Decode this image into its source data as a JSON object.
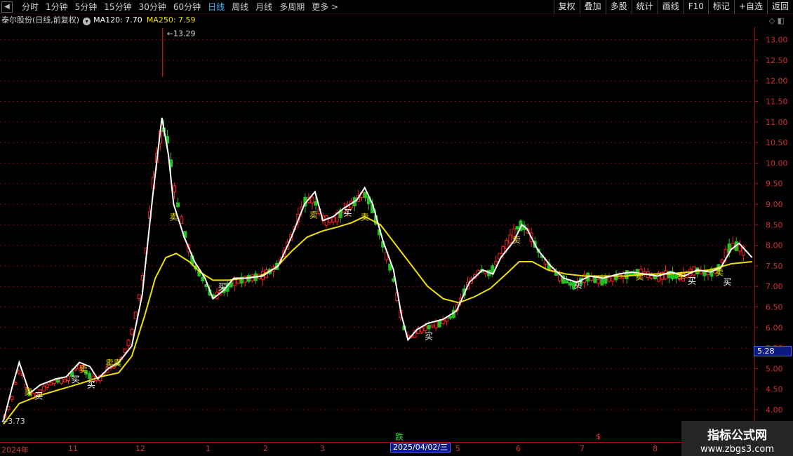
{
  "toolbar": {
    "nav_glyph": "◀",
    "periods": [
      {
        "label": "分时",
        "active": false
      },
      {
        "label": "1分钟",
        "active": false
      },
      {
        "label": "5分钟",
        "active": false
      },
      {
        "label": "15分钟",
        "active": false
      },
      {
        "label": "30分钟",
        "active": false
      },
      {
        "label": "60分钟",
        "active": false
      },
      {
        "label": "日线",
        "active": true
      },
      {
        "label": "周线",
        "active": false
      },
      {
        "label": "月线",
        "active": false
      },
      {
        "label": "多周期",
        "active": false
      },
      {
        "label": "更多 >",
        "active": false
      }
    ],
    "tools": [
      "复权",
      "叠加",
      "多股",
      "统计",
      "画线",
      "F10",
      "标记",
      "+自选",
      "返回"
    ]
  },
  "info": {
    "stock": "泰尔股份(日线,前复权)",
    "circle_glyph": "▾",
    "ma120_label": "MA120: 7.70",
    "ma250_label": "MA250: 7.59",
    "window_controls": "◇ ◧"
  },
  "colors": {
    "up": "#ff2020",
    "down": "#22c422",
    "ma120": "#ffffff",
    "ma250": "#f0e000",
    "grid": "#7a0a0a",
    "axis_text": "#d03030",
    "signal_sell": "#f0e000",
    "signal_buy": "#ffffff"
  },
  "chart_data": {
    "type": "candlestick",
    "y_ticks": [
      "4.00",
      "4.50",
      "5.00",
      "5.50",
      "6.00",
      "6.50",
      "7.00",
      "7.50",
      "8.00",
      "8.50",
      "9.00",
      "9.50",
      "10.00",
      "10.50",
      "11.00",
      "11.50",
      "12.00",
      "12.50",
      "13.00"
    ],
    "ylim": [
      3.6,
      13.3
    ],
    "high_marker": "13.29",
    "low_marker": "3.73",
    "current_price": "5.28",
    "price_trend": [
      [
        0,
        3.75
      ],
      [
        0.35,
        4.3
      ],
      [
        0.6,
        5.1
      ],
      [
        1,
        4.3
      ],
      [
        1.2,
        4.35
      ],
      [
        1.6,
        4.55
      ],
      [
        2.0,
        4.7
      ],
      [
        2.4,
        4.7
      ],
      [
        2.9,
        5.1
      ],
      [
        3.1,
        4.95
      ],
      [
        3.3,
        4.8
      ],
      [
        3.6,
        4.7
      ],
      [
        4.0,
        5.0
      ],
      [
        4.4,
        5.1
      ],
      [
        4.9,
        5.8
      ],
      [
        5.4,
        7.5
      ],
      [
        5.7,
        9.5
      ],
      [
        6.05,
        10.9
      ],
      [
        6.3,
        10.6
      ],
      [
        6.45,
        9.6
      ],
      [
        6.8,
        8.6
      ],
      [
        7.2,
        7.6
      ],
      [
        7.6,
        7.2
      ],
      [
        8.0,
        6.7
      ],
      [
        8.4,
        6.9
      ],
      [
        8.8,
        7.1
      ],
      [
        9.4,
        7.2
      ],
      [
        9.9,
        7.25
      ],
      [
        10.5,
        7.5
      ],
      [
        11.0,
        8.2
      ],
      [
        11.5,
        9.1
      ],
      [
        11.9,
        9.1
      ],
      [
        12.2,
        8.6
      ],
      [
        12.6,
        8.6
      ],
      [
        13.1,
        8.9
      ],
      [
        13.5,
        9.1
      ],
      [
        13.8,
        9.3
      ],
      [
        14.1,
        8.9
      ],
      [
        14.5,
        8.0
      ],
      [
        14.9,
        7.2
      ],
      [
        15.2,
        6.2
      ],
      [
        15.45,
        5.7
      ],
      [
        15.8,
        5.9
      ],
      [
        16.2,
        6.0
      ],
      [
        16.7,
        6.1
      ],
      [
        17.2,
        6.3
      ],
      [
        17.7,
        7.0
      ],
      [
        18.2,
        7.4
      ],
      [
        18.6,
        7.3
      ],
      [
        19.0,
        7.8
      ],
      [
        19.4,
        8.2
      ],
      [
        19.7,
        8.5
      ],
      [
        20.0,
        8.4
      ],
      [
        20.4,
        7.9
      ],
      [
        20.8,
        7.5
      ],
      [
        21.3,
        7.2
      ],
      [
        21.8,
        7.0
      ],
      [
        22.3,
        7.25
      ],
      [
        22.8,
        7.1
      ],
      [
        23.3,
        7.2
      ],
      [
        23.9,
        7.3
      ],
      [
        24.4,
        7.35
      ],
      [
        24.9,
        7.2
      ],
      [
        25.4,
        7.3
      ],
      [
        25.9,
        7.2
      ],
      [
        26.4,
        7.4
      ],
      [
        26.9,
        7.3
      ],
      [
        27.3,
        7.4
      ],
      [
        27.7,
        7.95
      ],
      [
        28.0,
        8.0
      ],
      [
        28.4,
        7.8
      ]
    ],
    "ma120": [
      [
        0,
        3.73
      ],
      [
        0.35,
        4.6
      ],
      [
        0.6,
        5.15
      ],
      [
        1,
        4.4
      ],
      [
        1.4,
        4.6
      ],
      [
        2.0,
        4.75
      ],
      [
        2.4,
        4.8
      ],
      [
        2.9,
        5.15
      ],
      [
        3.3,
        5.05
      ],
      [
        3.6,
        4.75
      ],
      [
        4.0,
        5.0
      ],
      [
        4.4,
        5.15
      ],
      [
        4.9,
        5.55
      ],
      [
        5.3,
        6.8
      ],
      [
        5.7,
        9.2
      ],
      [
        6.05,
        11.1
      ],
      [
        6.3,
        10.2
      ],
      [
        6.5,
        9.0
      ],
      [
        6.9,
        8.2
      ],
      [
        7.3,
        7.6
      ],
      [
        7.7,
        7.2
      ],
      [
        8.0,
        6.7
      ],
      [
        8.4,
        6.9
      ],
      [
        8.8,
        7.2
      ],
      [
        9.3,
        7.2
      ],
      [
        9.9,
        7.25
      ],
      [
        10.5,
        7.5
      ],
      [
        11.0,
        8.2
      ],
      [
        11.5,
        9.0
      ],
      [
        11.9,
        9.3
      ],
      [
        12.2,
        8.6
      ],
      [
        12.6,
        8.7
      ],
      [
        13.0,
        8.9
      ],
      [
        13.5,
        9.1
      ],
      [
        13.8,
        9.4
      ],
      [
        14.1,
        9.0
      ],
      [
        14.5,
        8.1
      ],
      [
        14.9,
        7.4
      ],
      [
        15.2,
        6.3
      ],
      [
        15.45,
        5.7
      ],
      [
        15.8,
        5.95
      ],
      [
        16.2,
        6.1
      ],
      [
        16.8,
        6.2
      ],
      [
        17.3,
        6.4
      ],
      [
        17.8,
        7.1
      ],
      [
        18.3,
        7.4
      ],
      [
        18.7,
        7.3
      ],
      [
        19.0,
        7.7
      ],
      [
        19.5,
        8.1
      ],
      [
        19.8,
        8.5
      ],
      [
        20.0,
        8.4
      ],
      [
        20.4,
        7.9
      ],
      [
        20.9,
        7.5
      ],
      [
        21.4,
        7.2
      ],
      [
        21.9,
        7.1
      ],
      [
        22.4,
        7.25
      ],
      [
        22.9,
        7.2
      ],
      [
        23.5,
        7.3
      ],
      [
        24.0,
        7.35
      ],
      [
        24.5,
        7.3
      ],
      [
        25.0,
        7.25
      ],
      [
        25.5,
        7.35
      ],
      [
        26.0,
        7.25
      ],
      [
        26.5,
        7.4
      ],
      [
        27.0,
        7.35
      ],
      [
        27.4,
        7.45
      ],
      [
        27.8,
        7.9
      ],
      [
        28.1,
        8.05
      ],
      [
        28.6,
        7.7
      ]
    ],
    "ma250": [
      [
        0,
        3.65
      ],
      [
        0.6,
        4.15
      ],
      [
        1.4,
        4.35
      ],
      [
        2.2,
        4.5
      ],
      [
        3.0,
        4.65
      ],
      [
        3.7,
        4.8
      ],
      [
        4.4,
        4.9
      ],
      [
        4.9,
        5.3
      ],
      [
        5.4,
        6.3
      ],
      [
        5.8,
        7.2
      ],
      [
        6.2,
        7.7
      ],
      [
        6.6,
        7.8
      ],
      [
        7.1,
        7.6
      ],
      [
        7.5,
        7.35
      ],
      [
        8.0,
        7.15
      ],
      [
        8.6,
        7.15
      ],
      [
        9.2,
        7.2
      ],
      [
        9.8,
        7.25
      ],
      [
        10.4,
        7.45
      ],
      [
        11.0,
        7.85
      ],
      [
        11.6,
        8.2
      ],
      [
        12.2,
        8.35
      ],
      [
        12.8,
        8.45
      ],
      [
        13.3,
        8.55
      ],
      [
        13.8,
        8.7
      ],
      [
        14.4,
        8.5
      ],
      [
        15.0,
        8.0
      ],
      [
        15.6,
        7.5
      ],
      [
        16.2,
        7.0
      ],
      [
        16.8,
        6.7
      ],
      [
        17.4,
        6.6
      ],
      [
        18.0,
        6.75
      ],
      [
        18.6,
        6.95
      ],
      [
        19.2,
        7.3
      ],
      [
        19.7,
        7.6
      ],
      [
        20.2,
        7.6
      ],
      [
        20.8,
        7.4
      ],
      [
        21.5,
        7.3
      ],
      [
        22.2,
        7.25
      ],
      [
        23.0,
        7.25
      ],
      [
        23.8,
        7.25
      ],
      [
        24.6,
        7.3
      ],
      [
        25.4,
        7.3
      ],
      [
        26.2,
        7.35
      ],
      [
        27.0,
        7.4
      ],
      [
        27.8,
        7.55
      ],
      [
        28.6,
        7.6
      ]
    ],
    "signals": [
      {
        "x": 0.95,
        "price": 4.45,
        "kind": "sell",
        "label": "卖"
      },
      {
        "x": 1.35,
        "price": 4.35,
        "kind": "buy",
        "label": "买"
      },
      {
        "x": 2.75,
        "price": 4.75,
        "kind": "buy",
        "label": "买"
      },
      {
        "x": 3.05,
        "price": 5.0,
        "kind": "sell",
        "label": "卖"
      },
      {
        "x": 3.35,
        "price": 4.62,
        "kind": "buy",
        "label": "买"
      },
      {
        "x": 4.05,
        "price": 5.15,
        "kind": "sell",
        "label": "卖"
      },
      {
        "x": 4.35,
        "price": 5.15,
        "kind": "sell",
        "label": "卖"
      },
      {
        "x": 6.5,
        "price": 8.7,
        "kind": "sell",
        "label": "卖"
      },
      {
        "x": 8.35,
        "price": 7.0,
        "kind": "buy",
        "label": "买"
      },
      {
        "x": 11.85,
        "price": 8.75,
        "kind": "sell",
        "label": "卖"
      },
      {
        "x": 13.15,
        "price": 8.8,
        "kind": "buy",
        "label": "买"
      },
      {
        "x": 13.8,
        "price": 8.7,
        "kind": "sell",
        "label": "卖"
      },
      {
        "x": 16.25,
        "price": 5.8,
        "kind": "buy",
        "label": "买"
      },
      {
        "x": 19.6,
        "price": 8.15,
        "kind": "sell",
        "label": "卖"
      },
      {
        "x": 21.95,
        "price": 7.05,
        "kind": "buy",
        "label": "买"
      },
      {
        "x": 24.3,
        "price": 7.25,
        "kind": "sell",
        "label": "卖"
      },
      {
        "x": 25.9,
        "price": 7.28,
        "kind": "sell",
        "label": "卖"
      },
      {
        "x": 26.3,
        "price": 7.15,
        "kind": "buy",
        "label": "买"
      },
      {
        "x": 27.35,
        "price": 7.35,
        "kind": "sell",
        "label": "卖"
      },
      {
        "x": 27.65,
        "price": 7.12,
        "kind": "buy",
        "label": "买"
      }
    ]
  },
  "time_axis": {
    "labels": [
      "2024年",
      "11",
      "12",
      "1",
      "2",
      "3",
      "4",
      "5",
      "6",
      "7",
      "8"
    ],
    "cursor_date": "2025/04/02/三",
    "event_label": "跌",
    "dollar_mark": "$"
  },
  "watermark": {
    "title": "指标公式网",
    "url": "www.zbgs3.com"
  }
}
